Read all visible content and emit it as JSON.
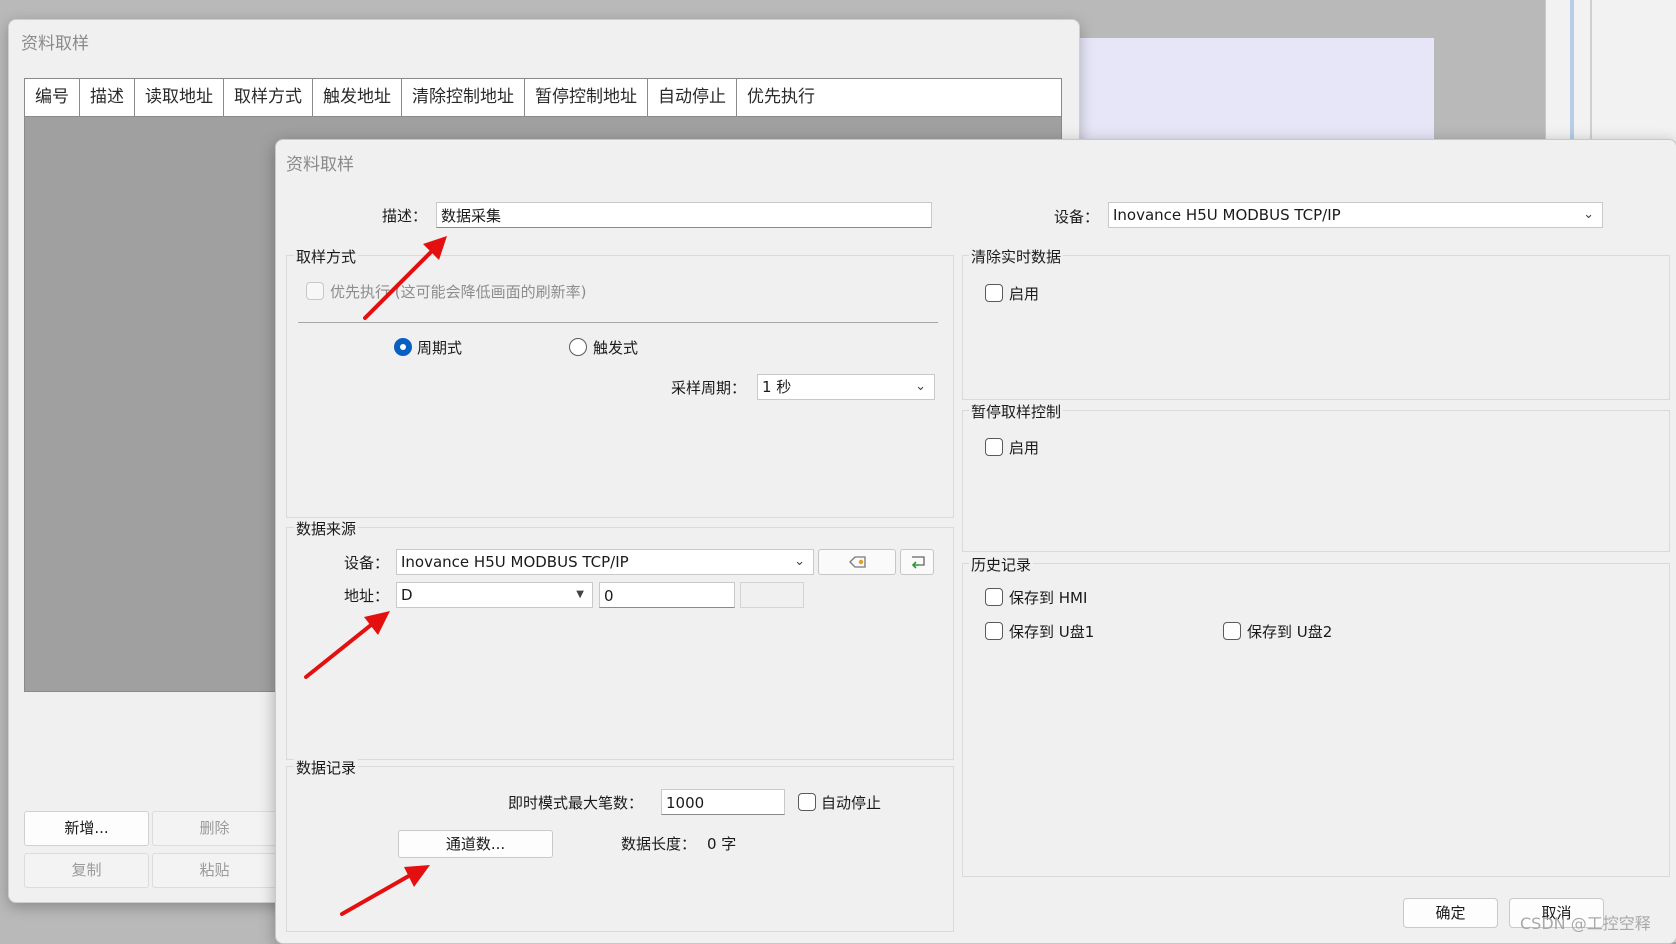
{
  "bg_window": {
    "title": "资料取样",
    "columns": [
      "编号",
      "描述",
      "读取地址",
      "取样方式",
      "触发地址",
      "清除控制地址",
      "暂停控制地址",
      "自动停止",
      "优先执行"
    ],
    "buttons": {
      "add": "新增...",
      "delete": "删除",
      "copy": "复制",
      "paste": "粘贴"
    }
  },
  "dialog": {
    "title": "资料取样",
    "description_label": "描述：",
    "description_value": "数据采集",
    "device_label": "设备：",
    "device_value": "Inovance H5U MODBUS TCP/IP",
    "sampling": {
      "title": "取样方式",
      "priority_label": "优先执行 (这可能会降低画面的刷新率)",
      "periodic_label": "周期式",
      "trigger_label": "触发式",
      "period_label": "采样周期：",
      "period_value": "1 秒"
    },
    "source": {
      "title": "数据来源",
      "device_label": "设备：",
      "device_value": "Inovance H5U MODBUS TCP/IP",
      "address_label": "地址：",
      "address_type": "D",
      "address_value": "0"
    },
    "record": {
      "title": "数据记录",
      "max_label": "即时模式最大笔数：",
      "max_value": "1000",
      "auto_stop_label": "自动停止",
      "channel_button": "通道数...",
      "length_label": "数据长度：",
      "length_value": "0 字"
    },
    "clear": {
      "title": "清除实时数据",
      "enable_label": "启用"
    },
    "pause": {
      "title": "暂停取样控制",
      "enable_label": "启用"
    },
    "history": {
      "title": "历史记录",
      "hmi_label": "保存到 HMI",
      "usb1_label": "保存到 U盘1",
      "usb2_label": "保存到 U盘2"
    },
    "ok_button": "确定",
    "cancel_button": "取消"
  },
  "watermark": "CSDN @工控空释",
  "colors": {
    "accent": "#0a5fc2",
    "annotation_arrow": "#e41010"
  }
}
